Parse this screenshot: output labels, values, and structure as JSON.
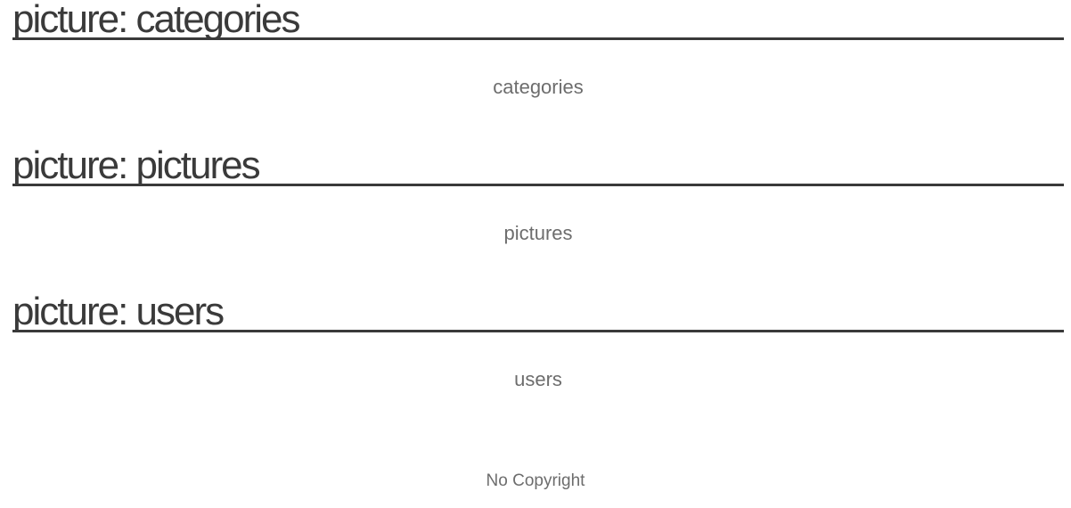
{
  "sections": [
    {
      "title": "picture: categories",
      "caption": "categories"
    },
    {
      "title": "picture: pictures",
      "caption": "pictures"
    },
    {
      "title": "picture: users",
      "caption": "users"
    }
  ],
  "footer": {
    "text": "No Copyright"
  },
  "colors": {
    "heading": "#3a3a3a",
    "caption": "#6d6d6d",
    "background": "#ffffff"
  }
}
